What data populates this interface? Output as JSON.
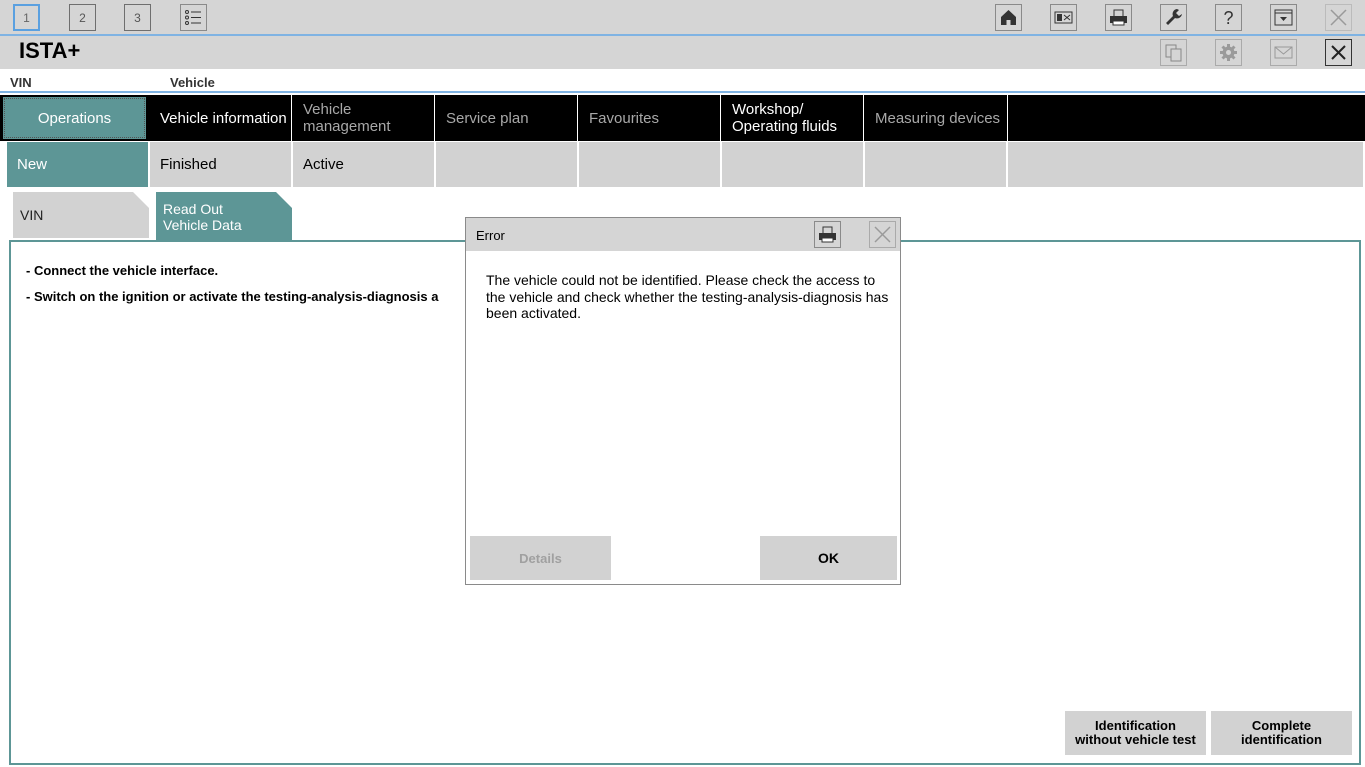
{
  "topbar": {
    "tabs": [
      "1",
      "2",
      "3"
    ],
    "icons": [
      "list-icon",
      "home-icon",
      "vehicle-image-icon",
      "printer-icon",
      "wrench-icon",
      "help-icon",
      "minimize-window-icon",
      "close-window-icon"
    ]
  },
  "titlebar": {
    "app_title": "ISTA+",
    "icons": [
      "copy-icon",
      "settings-icon",
      "mail-icon",
      "close-icon"
    ]
  },
  "vin_bar": {
    "vin_label": "VIN",
    "vehicle_label": "Vehicle"
  },
  "main_nav": {
    "items": [
      {
        "label": "Operations"
      },
      {
        "label": "Vehicle information"
      },
      {
        "label": "Vehicle management"
      },
      {
        "label": "Service plan"
      },
      {
        "label": "Favourites"
      },
      {
        "label": "Workshop/ Operating fluids"
      },
      {
        "label": "Measuring devices"
      }
    ]
  },
  "sub_nav": {
    "items": [
      {
        "label": "New"
      },
      {
        "label": "Finished"
      },
      {
        "label": "Active"
      }
    ]
  },
  "tabs": {
    "vin": "VIN",
    "read_out_line1": "Read Out",
    "read_out_line2": "Vehicle Data"
  },
  "content": {
    "instruction_1": "- Connect the vehicle interface.",
    "instruction_2": "- Switch on the ignition or activate the testing-analysis-diagnosis a",
    "identification_line1": "Identification",
    "identification_line2": "without vehicle test",
    "complete_line1": "Complete",
    "complete_line2": "identification"
  },
  "dialog": {
    "title": "Error",
    "message": "The vehicle could not be identified. Please check the access to the vehicle and check whether the testing-analysis-diagnosis has been activated.",
    "details_label": "Details",
    "ok_label": "OK"
  },
  "colors": {
    "accent_teal": "#5d9696",
    "toolbar_gray": "#d5d5d5",
    "highlight_blue": "#7fb3e3"
  }
}
